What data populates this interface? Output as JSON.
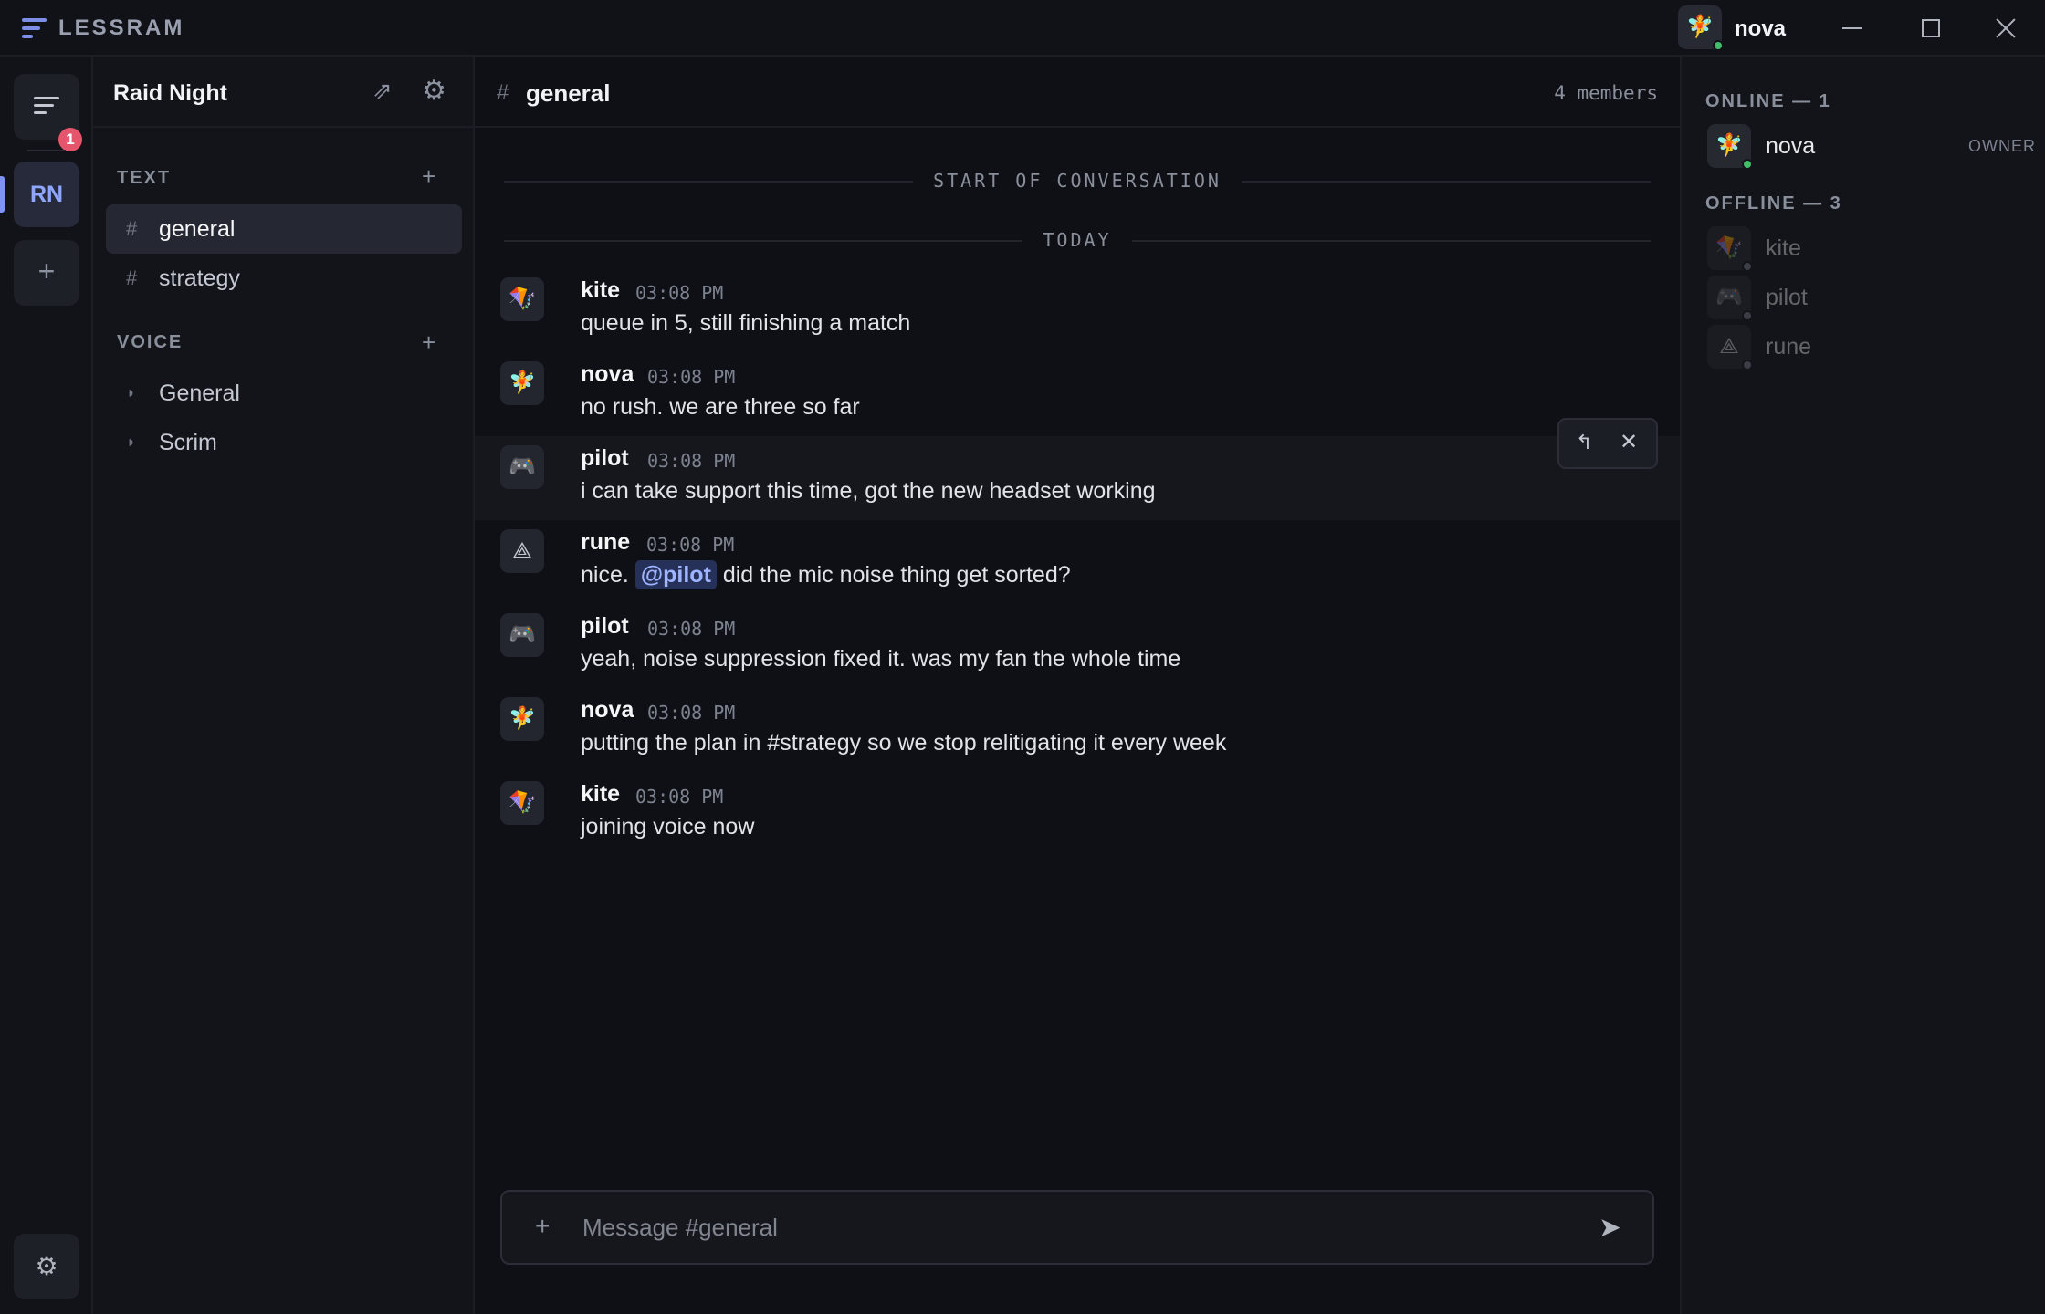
{
  "app": {
    "name": "LESSRAM"
  },
  "colors": {
    "accent": "#7f93f5",
    "online": "#3fbf6a",
    "offline": "#4a4e58",
    "badge": "#e5566c",
    "mention_bg": "#26315a"
  },
  "titlebar": {
    "user_name": "nova",
    "user_avatar": "fairy-avatar-icon",
    "user_status": "online",
    "controls": [
      "minimize-icon",
      "maximize-icon",
      "close-icon"
    ]
  },
  "rail": {
    "notification_count": "1",
    "server_initials": "RN",
    "add_label": "+",
    "settings_icon": "gear-icon"
  },
  "server": {
    "name": "Raid Night",
    "invite_icon": "invite-arrow-icon",
    "settings_icon": "gear-icon"
  },
  "categories": {
    "text": {
      "label": "TEXT",
      "add": "+"
    },
    "voice": {
      "label": "VOICE",
      "add": "+"
    }
  },
  "text_channels": [
    {
      "glyph": "#",
      "name": "general",
      "active": true
    },
    {
      "glyph": "#",
      "name": "strategy",
      "active": false
    }
  ],
  "voice_channels": [
    {
      "glyph": "◗",
      "name": "General"
    },
    {
      "glyph": "◗",
      "name": "Scrim"
    }
  ],
  "channel": {
    "hash": "#",
    "name": "general",
    "members_label": "4 members"
  },
  "dividers": {
    "start": "START OF CONVERSATION",
    "today": "TODAY"
  },
  "messages": [
    {
      "author": "kite",
      "avatar": "🪁",
      "time": "03:08 PM",
      "text": "queue in 5, still finishing a match"
    },
    {
      "author": "nova",
      "avatar": "🧚",
      "time": "03:08 PM",
      "text": "no rush. we are three so far"
    },
    {
      "author": "pilot",
      "avatar": "🎮",
      "time": "03:08 PM",
      "text": "i can take support this time, got the new headset working"
    },
    {
      "author": "rune",
      "avatar": "⟁",
      "time": "03:08 PM",
      "text_before": "nice. ",
      "mention": "@pilot",
      "text_after": " did the mic noise thing get sorted?"
    },
    {
      "author": "pilot",
      "avatar": "🎮",
      "time": "03:08 PM",
      "text": "yeah, noise suppression fixed it. was my fan the whole time"
    },
    {
      "author": "nova",
      "avatar": "🧚",
      "time": "03:08 PM",
      "text": "putting the plan in #strategy so we stop relitigating it every week"
    },
    {
      "author": "kite",
      "avatar": "🪁",
      "time": "03:08 PM",
      "text": "joining voice now"
    }
  ],
  "hover_toolbar": {
    "reply": "↰",
    "close": "✕"
  },
  "composer": {
    "add": "+",
    "placeholder": "Message #general",
    "value": "",
    "send_icon": "send-icon"
  },
  "members_panel": {
    "online_label": "ONLINE — 1",
    "offline_label": "OFFLINE — 3",
    "online": [
      {
        "name": "nova",
        "avatar": "🧚",
        "role": "OWNER"
      }
    ],
    "offline": [
      {
        "name": "kite",
        "avatar": "🪁"
      },
      {
        "name": "pilot",
        "avatar": "🎮"
      },
      {
        "name": "rune",
        "avatar": "⟁"
      }
    ]
  }
}
